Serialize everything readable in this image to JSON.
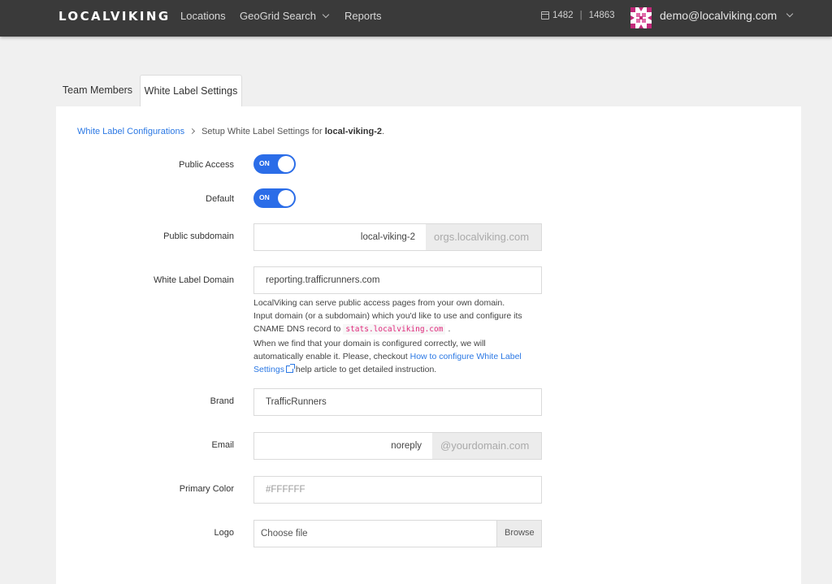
{
  "header": {
    "logo": "LOCALVIKING",
    "nav": {
      "locations": "Locations",
      "geogrid": "GeoGrid Search",
      "reports": "Reports"
    },
    "credits": {
      "first": "1482",
      "separator": "|",
      "second": "14863"
    },
    "user_email": "demo@localviking.com"
  },
  "tabs": {
    "team": "Team Members",
    "white_label": "White Label Settings"
  },
  "breadcrumb": {
    "link": "White Label Configurations",
    "text": "Setup White Label Settings for ",
    "org": "local-viking-2",
    "end": "."
  },
  "form": {
    "public_access": {
      "label": "Public Access",
      "state": "ON"
    },
    "default": {
      "label": "Default",
      "state": "ON"
    },
    "public_subdomain": {
      "label": "Public subdomain",
      "value": "local-viking-2",
      "suffix": "orgs.localviking.com"
    },
    "white_label_domain": {
      "label": "White Label Domain",
      "value": "reporting.trafficrunners.com"
    },
    "help": {
      "line1": "LocalViking can serve public access pages from your own domain.",
      "line2": "Input domain (or a subdomain) which you'd like to use and configure its",
      "line3_pre": "CNAME DNS record to",
      "cname": "stats.localviking.com",
      "line3_post": ".",
      "line4": "When we find that your domain is configured correctly, we will",
      "line5_pre": "automatically enable it. Please, checkout ",
      "link": "How to configure White Label Settings",
      "line6_post": " help article to get detailed instruction."
    },
    "brand": {
      "label": "Brand",
      "value": "TrafficRunners"
    },
    "email": {
      "label": "Email",
      "value": "noreply",
      "suffix": "@yourdomain.com"
    },
    "primary_color": {
      "label": "Primary Color",
      "placeholder": "#FFFFFF"
    },
    "logo": {
      "label": "Logo",
      "placeholder": "Choose file",
      "browse": "Browse"
    }
  },
  "colors": {
    "accent": "#2b6de8",
    "link": "#2b78e4",
    "topbar": "#3a3a3a",
    "code": "#e0287b"
  }
}
